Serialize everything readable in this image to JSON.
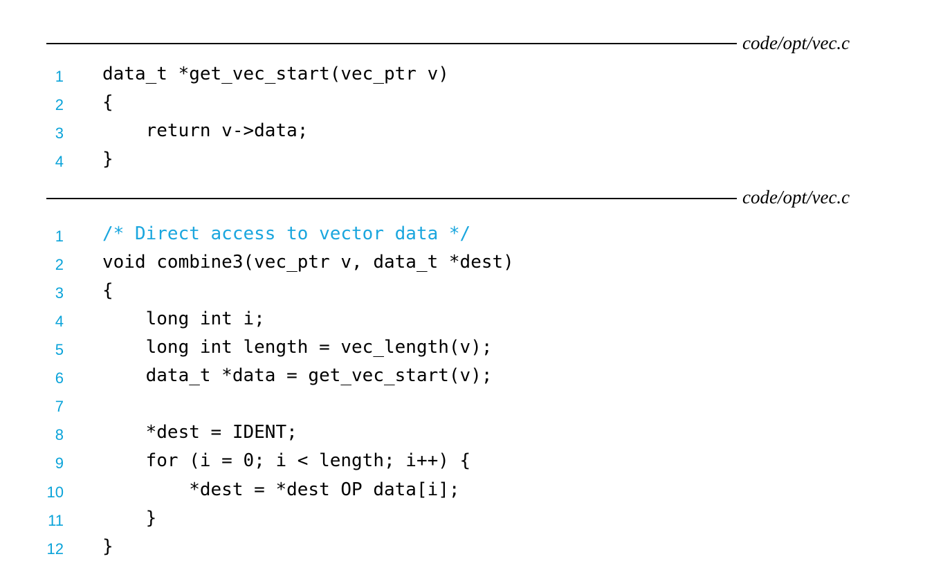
{
  "listing1": {
    "filename": "code/opt/vec.c",
    "lines": [
      {
        "num": "1",
        "text": "data_t *get_vec_start(vec_ptr v)"
      },
      {
        "num": "2",
        "text": "{"
      },
      {
        "num": "3",
        "text": "    return v->data;"
      },
      {
        "num": "4",
        "text": "}"
      }
    ]
  },
  "listing2": {
    "filename": "code/opt/vec.c",
    "lines": [
      {
        "num": "1",
        "text": "/* Direct access to vector data */",
        "kind": "comment"
      },
      {
        "num": "2",
        "text": "void combine3(vec_ptr v, data_t *dest)"
      },
      {
        "num": "3",
        "text": "{"
      },
      {
        "num": "4",
        "text": "    long int i;"
      },
      {
        "num": "5",
        "text": "    long int length = vec_length(v);"
      },
      {
        "num": "6",
        "text": "    data_t *data = get_vec_start(v);"
      },
      {
        "num": "7",
        "text": ""
      },
      {
        "num": "8",
        "text": "    *dest = IDENT;"
      },
      {
        "num": "9",
        "text": "    for (i = 0; i < length; i++) {"
      },
      {
        "num": "10",
        "text": "        *dest = *dest OP data[i];"
      },
      {
        "num": "11",
        "text": "    }"
      },
      {
        "num": "12",
        "text": "}"
      }
    ]
  },
  "colors": {
    "line_number": "#0aa3d9",
    "comment": "#1aa6de",
    "text": "#000000"
  }
}
